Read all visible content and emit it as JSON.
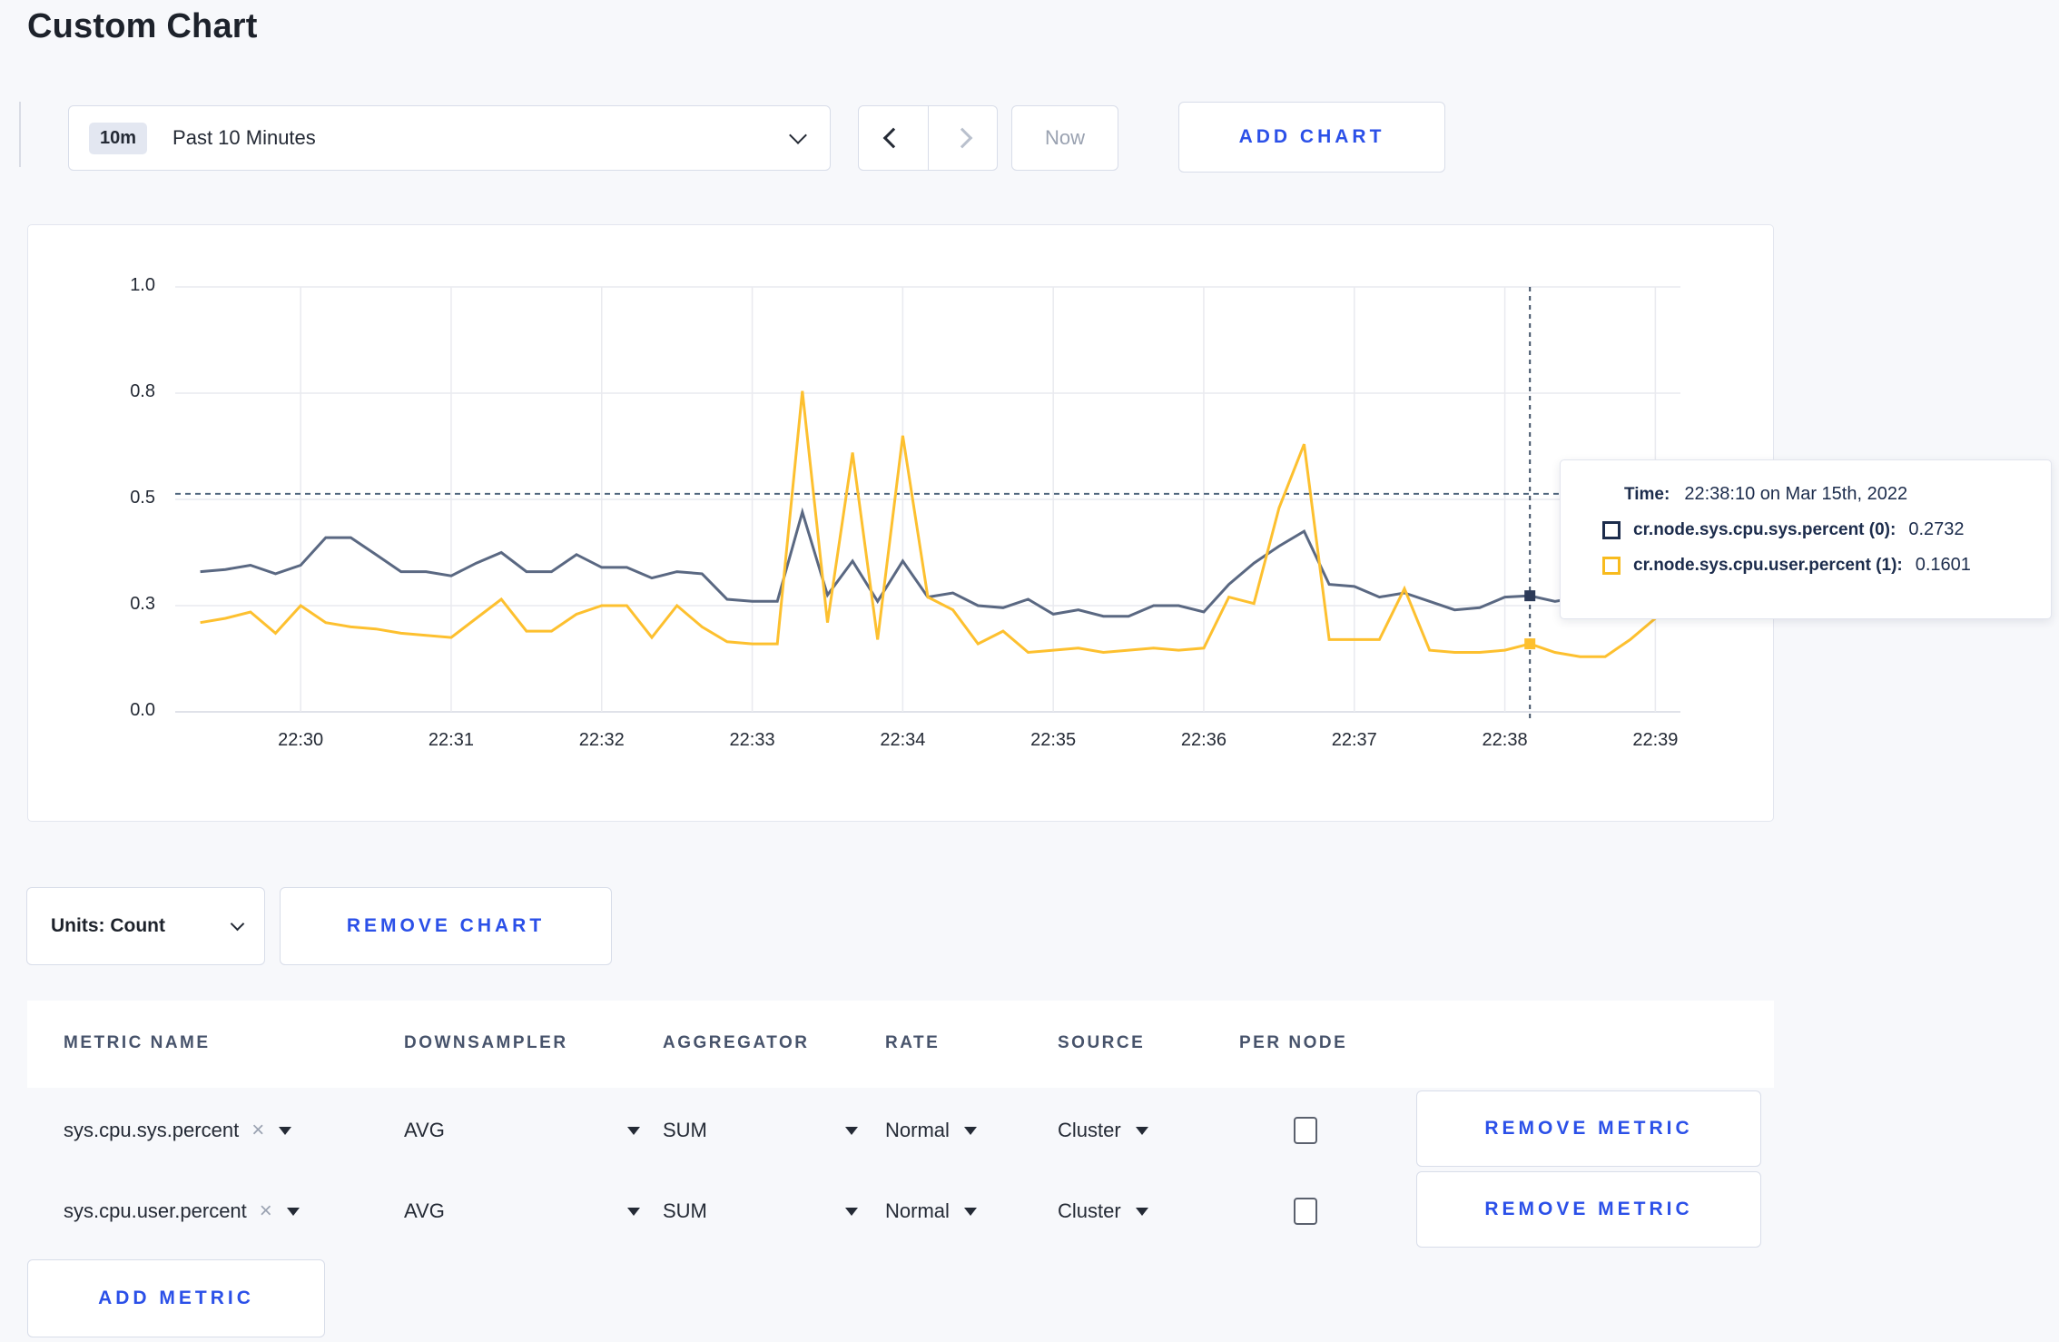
{
  "page": {
    "title": "Custom Chart"
  },
  "toolbar": {
    "range_badge": "10m",
    "range_label": "Past 10 Minutes",
    "now_label": "Now",
    "add_chart_label": "ADD CHART"
  },
  "icons": {
    "close": "×"
  },
  "accent_blue": "#2b50e8",
  "tooltip": {
    "time_label": "Time:",
    "time_value": "22:38:10 on Mar 15th, 2022",
    "series": [
      {
        "name": "cr.node.sys.cpu.sys.percent (0):",
        "value": "0.2732",
        "swatch_color": "#1c2c4c"
      },
      {
        "name": "cr.node.sys.cpu.user.percent (1):",
        "value": "0.1601",
        "swatch_color": "#f8bb1e"
      }
    ]
  },
  "chart_data": {
    "type": "line",
    "title": "",
    "xlabel": "",
    "ylabel": "",
    "ylim": [
      0,
      1
    ],
    "grid": true,
    "legend_position": "tooltip",
    "y_ticks": [
      {
        "v": 0.0,
        "label": "0.0"
      },
      {
        "v": 0.25,
        "label": "0.3"
      },
      {
        "v": 0.5,
        "label": "0.5"
      },
      {
        "v": 0.75,
        "label": "0.8"
      },
      {
        "v": 1.0,
        "label": "1.0"
      }
    ],
    "x_ticks": [
      "22:30",
      "22:31",
      "22:32",
      "22:33",
      "22:34",
      "22:35",
      "22:36",
      "22:37",
      "22:38",
      "22:39"
    ],
    "x": [
      "22:29:20",
      "22:29:30",
      "22:29:40",
      "22:29:50",
      "22:30:00",
      "22:30:10",
      "22:30:20",
      "22:30:30",
      "22:30:40",
      "22:30:50",
      "22:31:00",
      "22:31:10",
      "22:31:20",
      "22:31:30",
      "22:31:40",
      "22:31:50",
      "22:32:00",
      "22:32:10",
      "22:32:20",
      "22:32:30",
      "22:32:40",
      "22:32:50",
      "22:33:00",
      "22:33:10",
      "22:33:20",
      "22:33:30",
      "22:33:40",
      "22:33:50",
      "22:34:00",
      "22:34:10",
      "22:34:20",
      "22:34:30",
      "22:34:40",
      "22:34:50",
      "22:35:00",
      "22:35:10",
      "22:35:20",
      "22:35:30",
      "22:35:40",
      "22:35:50",
      "22:36:00",
      "22:36:10",
      "22:36:20",
      "22:36:30",
      "22:36:40",
      "22:36:50",
      "22:37:00",
      "22:37:10",
      "22:37:20",
      "22:37:30",
      "22:37:40",
      "22:37:50",
      "22:38:00",
      "22:38:10",
      "22:38:20",
      "22:38:30",
      "22:38:40",
      "22:38:50",
      "22:39:00",
      "22:39:10"
    ],
    "series": [
      {
        "name": "cr.node.sys.cpu.sys.percent (0)",
        "color": "#5a6882",
        "values": [
          0.33,
          0.335,
          0.345,
          0.325,
          0.345,
          0.41,
          0.41,
          0.37,
          0.33,
          0.33,
          0.32,
          0.35,
          0.375,
          0.33,
          0.33,
          0.37,
          0.34,
          0.34,
          0.315,
          0.33,
          0.325,
          0.265,
          0.26,
          0.26,
          0.47,
          0.275,
          0.355,
          0.26,
          0.355,
          0.27,
          0.28,
          0.25,
          0.245,
          0.265,
          0.23,
          0.24,
          0.225,
          0.225,
          0.25,
          0.25,
          0.235,
          0.3,
          0.35,
          0.39,
          0.425,
          0.3,
          0.295,
          0.27,
          0.28,
          0.26,
          0.24,
          0.245,
          0.27,
          0.2732,
          0.26,
          0.27,
          0.28,
          0.3,
          0.3,
          0.28
        ]
      },
      {
        "name": "cr.node.sys.cpu.user.percent (1)",
        "color": "#fdc02f",
        "values": [
          0.21,
          0.22,
          0.235,
          0.185,
          0.25,
          0.21,
          0.2,
          0.195,
          0.185,
          0.18,
          0.175,
          0.22,
          0.265,
          0.19,
          0.19,
          0.23,
          0.25,
          0.25,
          0.175,
          0.25,
          0.2,
          0.165,
          0.16,
          0.16,
          0.755,
          0.21,
          0.61,
          0.17,
          0.65,
          0.27,
          0.24,
          0.16,
          0.19,
          0.14,
          0.145,
          0.15,
          0.14,
          0.145,
          0.15,
          0.145,
          0.15,
          0.27,
          0.255,
          0.48,
          0.63,
          0.17,
          0.17,
          0.17,
          0.29,
          0.145,
          0.14,
          0.14,
          0.145,
          0.1601,
          0.14,
          0.13,
          0.13,
          0.17,
          0.22,
          0.27
        ]
      }
    ],
    "guideline_y": 0.513,
    "crosshair_index": 53,
    "crosshair_time": "22:38:10",
    "highlighted_points": [
      {
        "series": 0,
        "x": "22:38:10",
        "value": 0.2732
      },
      {
        "series": 1,
        "x": "22:38:10",
        "value": 0.1601
      }
    ]
  },
  "controls": {
    "units_label": "Units: Count",
    "remove_chart_label": "REMOVE CHART",
    "add_metric_label": "ADD METRIC",
    "remove_metric_label": "REMOVE METRIC"
  },
  "table": {
    "headers": [
      "METRIC NAME",
      "DOWNSAMPLER",
      "AGGREGATOR",
      "RATE",
      "SOURCE",
      "PER NODE"
    ],
    "rows": [
      {
        "metric": "sys.cpu.sys.percent",
        "downsampler": "AVG",
        "aggregator": "SUM",
        "rate": "Normal",
        "source": "Cluster",
        "per_node_checked": false
      },
      {
        "metric": "sys.cpu.user.percent",
        "downsampler": "AVG",
        "aggregator": "SUM",
        "rate": "Normal",
        "source": "Cluster",
        "per_node_checked": false
      }
    ]
  }
}
